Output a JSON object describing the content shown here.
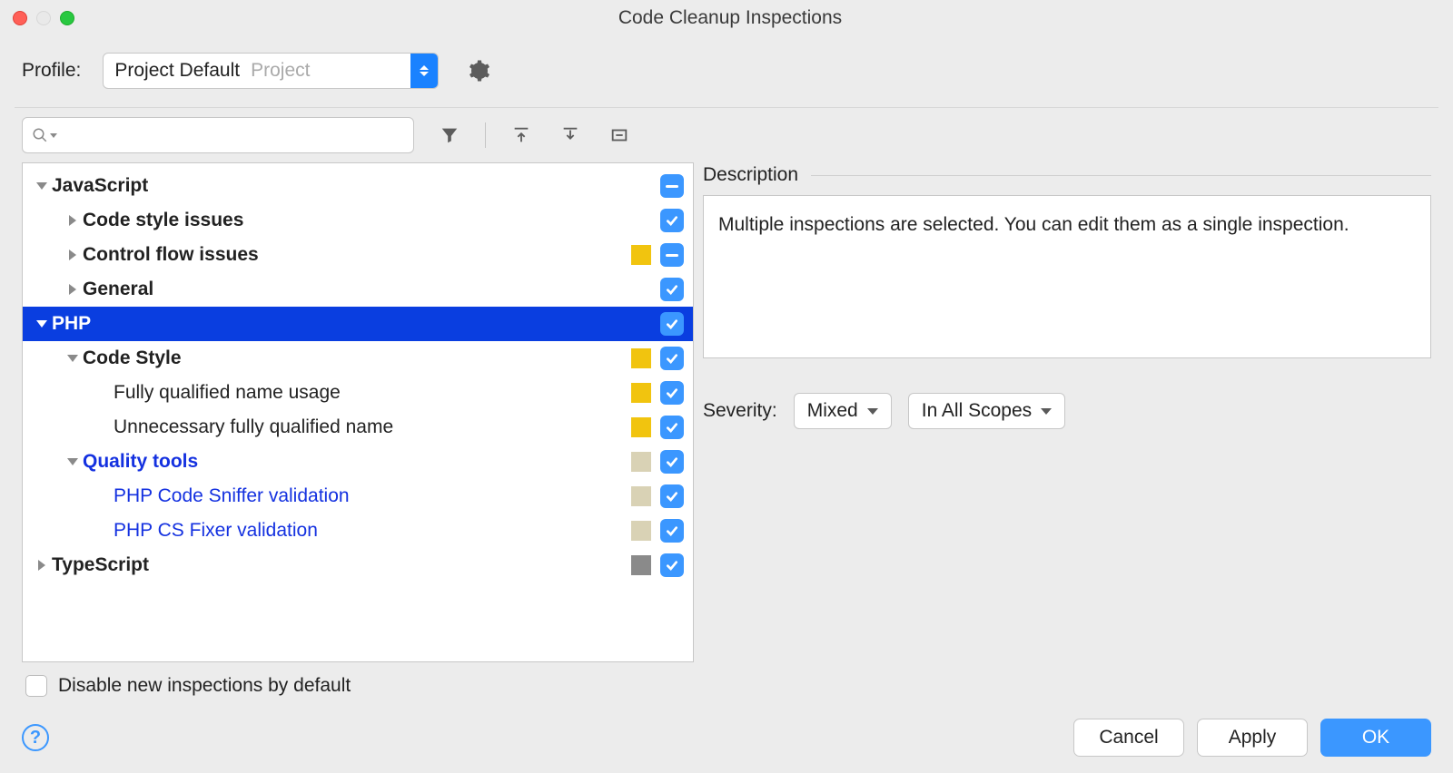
{
  "window": {
    "title": "Code Cleanup Inspections"
  },
  "profile": {
    "label": "Profile:",
    "value": "Project Default",
    "hint": "Project"
  },
  "search": {
    "placeholder": ""
  },
  "tree": [
    {
      "label": "JavaScript",
      "depth": 0,
      "bold": true,
      "toggle": "expanded",
      "swatch": "none",
      "check": "mixed",
      "selected": false,
      "blue": false
    },
    {
      "label": "Code style issues",
      "depth": 1,
      "bold": true,
      "toggle": "collapsed",
      "swatch": "none",
      "check": "checked",
      "selected": false,
      "blue": false
    },
    {
      "label": "Control flow issues",
      "depth": 1,
      "bold": true,
      "toggle": "collapsed",
      "swatch": "yellow",
      "check": "mixed",
      "selected": false,
      "blue": false
    },
    {
      "label": "General",
      "depth": 1,
      "bold": true,
      "toggle": "collapsed",
      "swatch": "none",
      "check": "checked",
      "selected": false,
      "blue": false
    },
    {
      "label": "PHP",
      "depth": 0,
      "bold": true,
      "toggle": "expanded",
      "swatch": "none",
      "check": "checked",
      "selected": true,
      "blue": false
    },
    {
      "label": "Code Style",
      "depth": 1,
      "bold": true,
      "toggle": "expanded",
      "swatch": "yellow",
      "check": "checked",
      "selected": false,
      "blue": false
    },
    {
      "label": "Fully qualified name usage",
      "depth": 2,
      "bold": false,
      "toggle": "",
      "swatch": "yellow",
      "check": "checked",
      "selected": false,
      "blue": false
    },
    {
      "label": "Unnecessary fully qualified name",
      "depth": 2,
      "bold": false,
      "toggle": "",
      "swatch": "yellow",
      "check": "checked",
      "selected": false,
      "blue": false
    },
    {
      "label": "Quality tools",
      "depth": 1,
      "bold": true,
      "toggle": "expanded",
      "swatch": "tan",
      "check": "checked",
      "selected": false,
      "blue": true
    },
    {
      "label": "PHP Code Sniffer validation",
      "depth": 2,
      "bold": false,
      "toggle": "",
      "swatch": "tan",
      "check": "checked",
      "selected": false,
      "blue": true
    },
    {
      "label": "PHP CS Fixer validation",
      "depth": 2,
      "bold": false,
      "toggle": "",
      "swatch": "tan",
      "check": "checked",
      "selected": false,
      "blue": true
    },
    {
      "label": "TypeScript",
      "depth": 0,
      "bold": true,
      "toggle": "collapsed",
      "swatch": "grey",
      "check": "checked",
      "selected": false,
      "blue": false
    }
  ],
  "disable": {
    "label": "Disable new inspections by default"
  },
  "description": {
    "header": "Description",
    "text": "Multiple inspections are selected. You can edit them as a single inspection."
  },
  "severity": {
    "label": "Severity:",
    "value": "Mixed",
    "scope": "In All Scopes"
  },
  "buttons": {
    "cancel": "Cancel",
    "apply": "Apply",
    "ok": "OK"
  }
}
